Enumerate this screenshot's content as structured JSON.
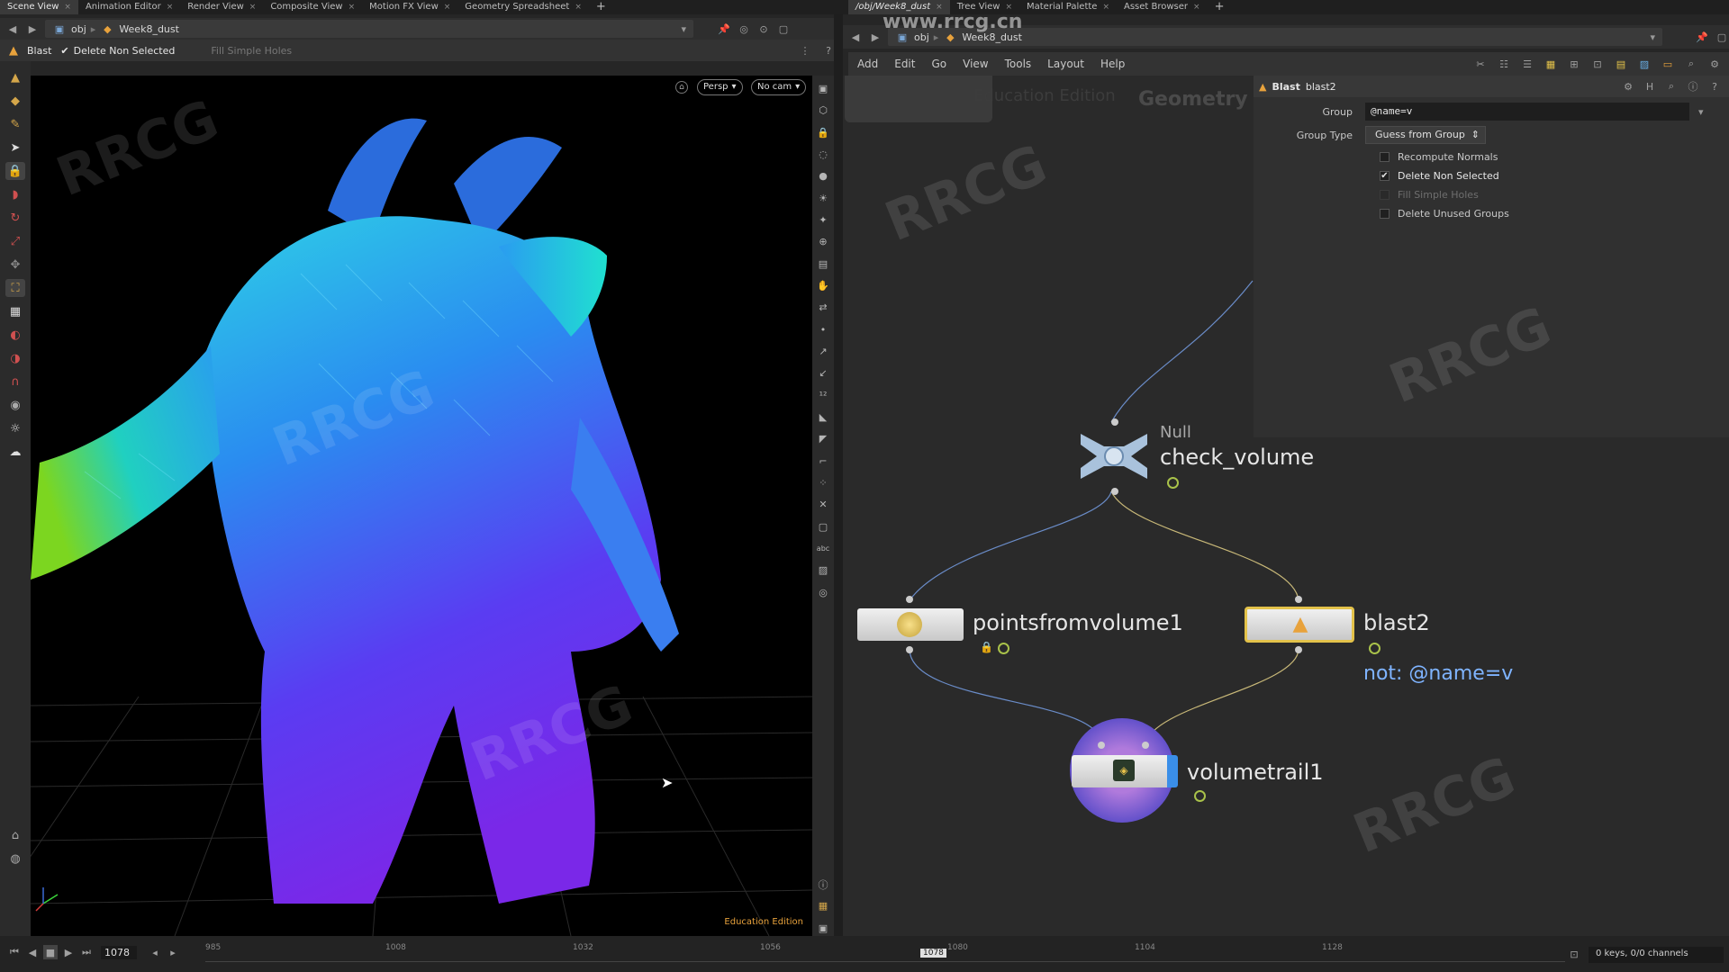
{
  "left_tabs": [
    "Scene View",
    "Animation Editor",
    "Render View",
    "Composite View",
    "Motion FX View",
    "Geometry Spreadsheet"
  ],
  "right_tabs": [
    "/obj/Week8_dust",
    "Tree View",
    "Material Palette",
    "Asset Browser"
  ],
  "left_path": {
    "root": "obj",
    "node": "Week8_dust"
  },
  "right_path": {
    "root": "obj",
    "node": "Week8_dust"
  },
  "operator_bar": {
    "node_type": "Blast",
    "option1": "Delete Non Selected",
    "option2": "Fill Simple Holes"
  },
  "viewport": {
    "camera_view": "Persp",
    "camera": "No cam",
    "edition": "Education Edition"
  },
  "menu": [
    "Add",
    "Edit",
    "Go",
    "View",
    "Tools",
    "Layout",
    "Help"
  ],
  "network_header": {
    "edition": "Education Edition",
    "context": "Geometry"
  },
  "params": {
    "node_type": "Blast",
    "node_name": "blast2",
    "group_label": "Group",
    "group_value": "@name=v",
    "group_type_label": "Group Type",
    "group_type_value": "Guess from Group",
    "checkboxes": [
      {
        "label": "Recompute Normals",
        "checked": false,
        "enabled": true
      },
      {
        "label": "Delete Non Selected",
        "checked": true,
        "enabled": true
      },
      {
        "label": "Fill Simple Holes",
        "checked": false,
        "enabled": false
      },
      {
        "label": "Delete Unused Groups",
        "checked": false,
        "enabled": true
      }
    ]
  },
  "nodes": {
    "null_type": "Null",
    "null_name": "check_volume",
    "pfv_name": "pointsfromvolume1",
    "blast_name": "blast2",
    "blast_comment": "not: @name=v",
    "trail_name": "volumetrail1"
  },
  "timeline": {
    "frame": "1078",
    "current_marker": "1078",
    "ticks": [
      "985",
      "1008",
      "1032",
      "1056",
      "1080",
      "1104",
      "1128"
    ],
    "keys_info": "0 keys, 0/0 channels"
  },
  "watermark_site": "www.rrcg.cn",
  "watermark_text": "RRCG",
  "colors": {
    "accent_orange": "#e8a23c",
    "selected_yellow": "#e3c24a",
    "comment_blue": "#7fb4ff",
    "ok_green": "#a9c24a"
  }
}
